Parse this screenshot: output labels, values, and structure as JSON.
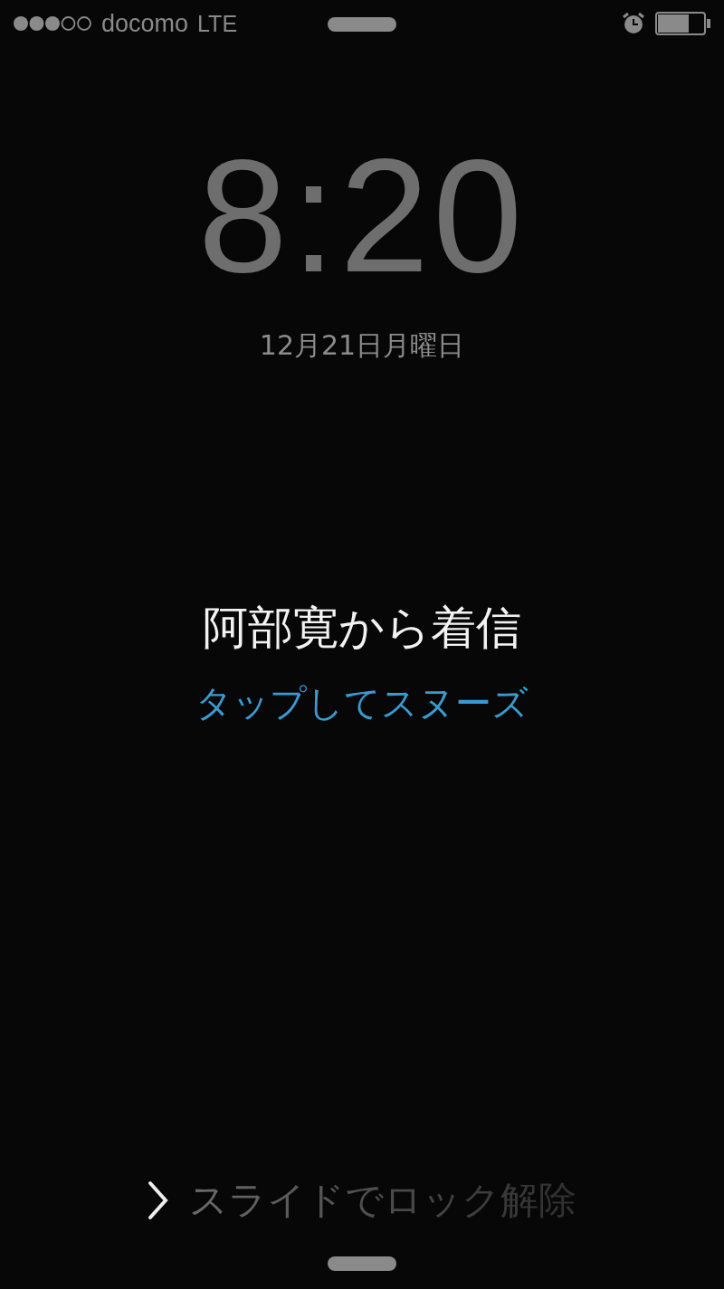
{
  "status_bar": {
    "carrier": "docomo",
    "network": "LTE"
  },
  "clock": {
    "time": "8:20",
    "date": "12月21日月曜日"
  },
  "alarm": {
    "title": "阿部寛から着信",
    "snooze": "タップしてスヌーズ"
  },
  "unlock": {
    "label": "スライドでロック解除"
  }
}
